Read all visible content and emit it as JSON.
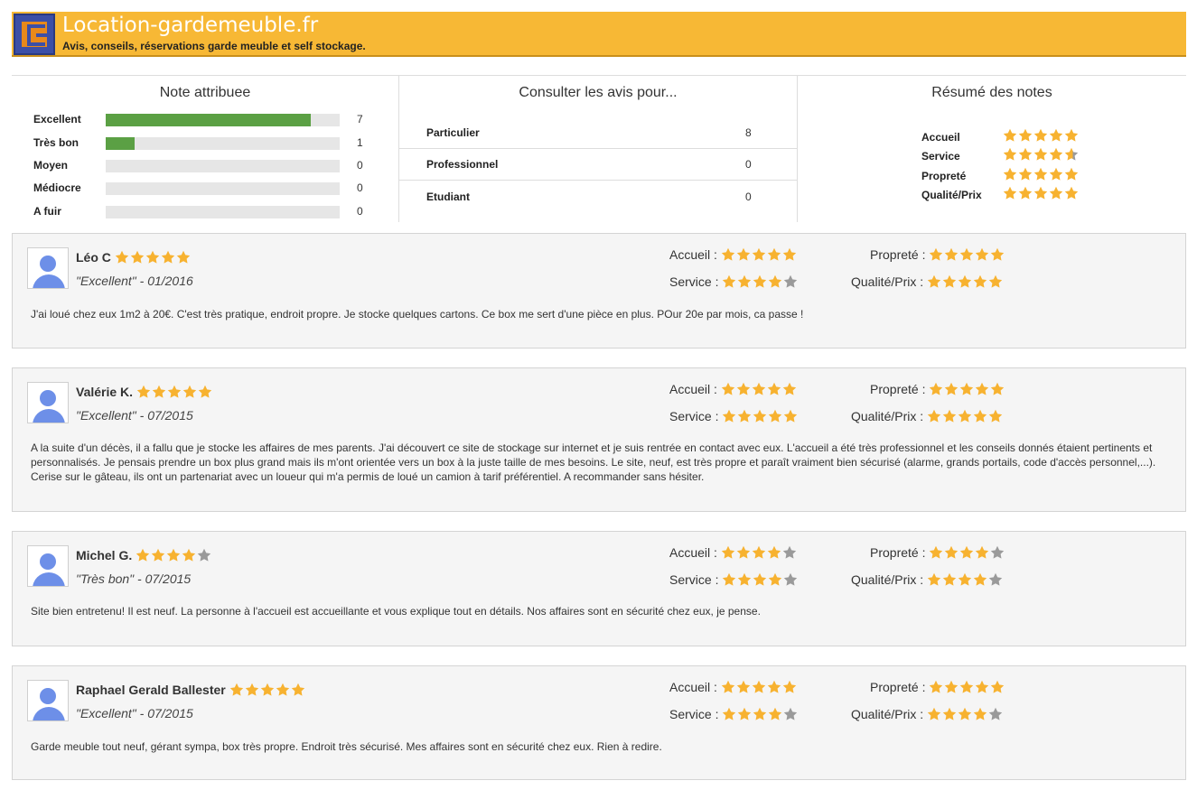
{
  "header": {
    "title": "Location-gardemeuble.fr",
    "subtitle": "Avis, conseils, réservations garde meuble et self stockage."
  },
  "note_attribuee": {
    "title": "Note attribuee",
    "rows": [
      {
        "label": "Excellent",
        "count": "7",
        "fraction": 0.875
      },
      {
        "label": "Très bon",
        "count": "1",
        "fraction": 0.125
      },
      {
        "label": "Moyen",
        "count": "0",
        "fraction": 0
      },
      {
        "label": "Médiocre",
        "count": "0",
        "fraction": 0
      },
      {
        "label": "A fuir",
        "count": "0",
        "fraction": 0
      }
    ]
  },
  "consulter": {
    "title": "Consulter les avis pour...",
    "rows": [
      {
        "label": "Particulier",
        "count": "8"
      },
      {
        "label": "Professionnel",
        "count": "0"
      },
      {
        "label": "Etudiant",
        "count": "0"
      }
    ]
  },
  "resume": {
    "title": "Résumé des notes",
    "rows": [
      {
        "label": "Accueil",
        "rating": 5
      },
      {
        "label": "Service",
        "rating": 4.6
      },
      {
        "label": "Propreté",
        "rating": 5
      },
      {
        "label": "Qualité/Prix",
        "rating": 5
      }
    ]
  },
  "criteria_labels": {
    "accueil": "Accueil :",
    "service": "Service :",
    "proprete": "Propreté :",
    "qualite": "Qualité/Prix :"
  },
  "reviews": [
    {
      "name": "Léo C",
      "rating": 5,
      "verdict": "\"Excellent\"  - 01/2016",
      "accueil": 5,
      "service": 4,
      "proprete": 5,
      "qualite": 5,
      "text": "J'ai loué chez eux 1m2 à 20€. C'est très pratique, endroit propre. Je stocke quelques cartons. Ce box me sert d'une pièce en plus. POur 20e par mois, ca passe !"
    },
    {
      "name": "Valérie K.",
      "rating": 5,
      "verdict": "\"Excellent\"  - 07/2015",
      "accueil": 5,
      "service": 5,
      "proprete": 5,
      "qualite": 5,
      "text": "A la suite d'un décès, il a fallu que je stocke les affaires de mes parents. J'ai découvert ce site de stockage sur internet et je suis rentrée en contact avec eux. L'accueil a été très professionnel et les conseils donnés étaient pertinents et personnalisés. Je pensais prendre un box plus grand mais ils m'ont orientée vers un box à la juste taille de mes besoins. Le site, neuf, est très propre et paraît vraiment bien sécurisé (alarme, grands portails, code d'accès personnel,...). Cerise sur le gâteau, ils ont un partenariat avec un loueur qui m'a permis de loué un camion à tarif préférentiel. A recommander sans hésiter."
    },
    {
      "name": "Michel G.",
      "rating": 4,
      "verdict": "\"Très bon\"  - 07/2015",
      "accueil": 4,
      "service": 4,
      "proprete": 4,
      "qualite": 4,
      "text": "Site bien entretenu! Il est neuf. La personne à l'accueil est accueillante et vous explique tout en détails. Nos affaires sont en sécurité chez eux, je pense."
    },
    {
      "name": "Raphael Gerald Ballester",
      "rating": 5,
      "verdict": "\"Excellent\"  - 07/2015",
      "accueil": 5,
      "service": 4,
      "proprete": 5,
      "qualite": 4,
      "text": "Garde meuble tout neuf, gérant sympa, box très propre. Endroit très sécurisé. Mes affaires sont en sécurité chez eux. Rien à redire."
    }
  ],
  "colors": {
    "header": "#f7b835",
    "star_on": "#f7b230",
    "star_off": "#9a9a9a",
    "bar": "#5ba044"
  }
}
